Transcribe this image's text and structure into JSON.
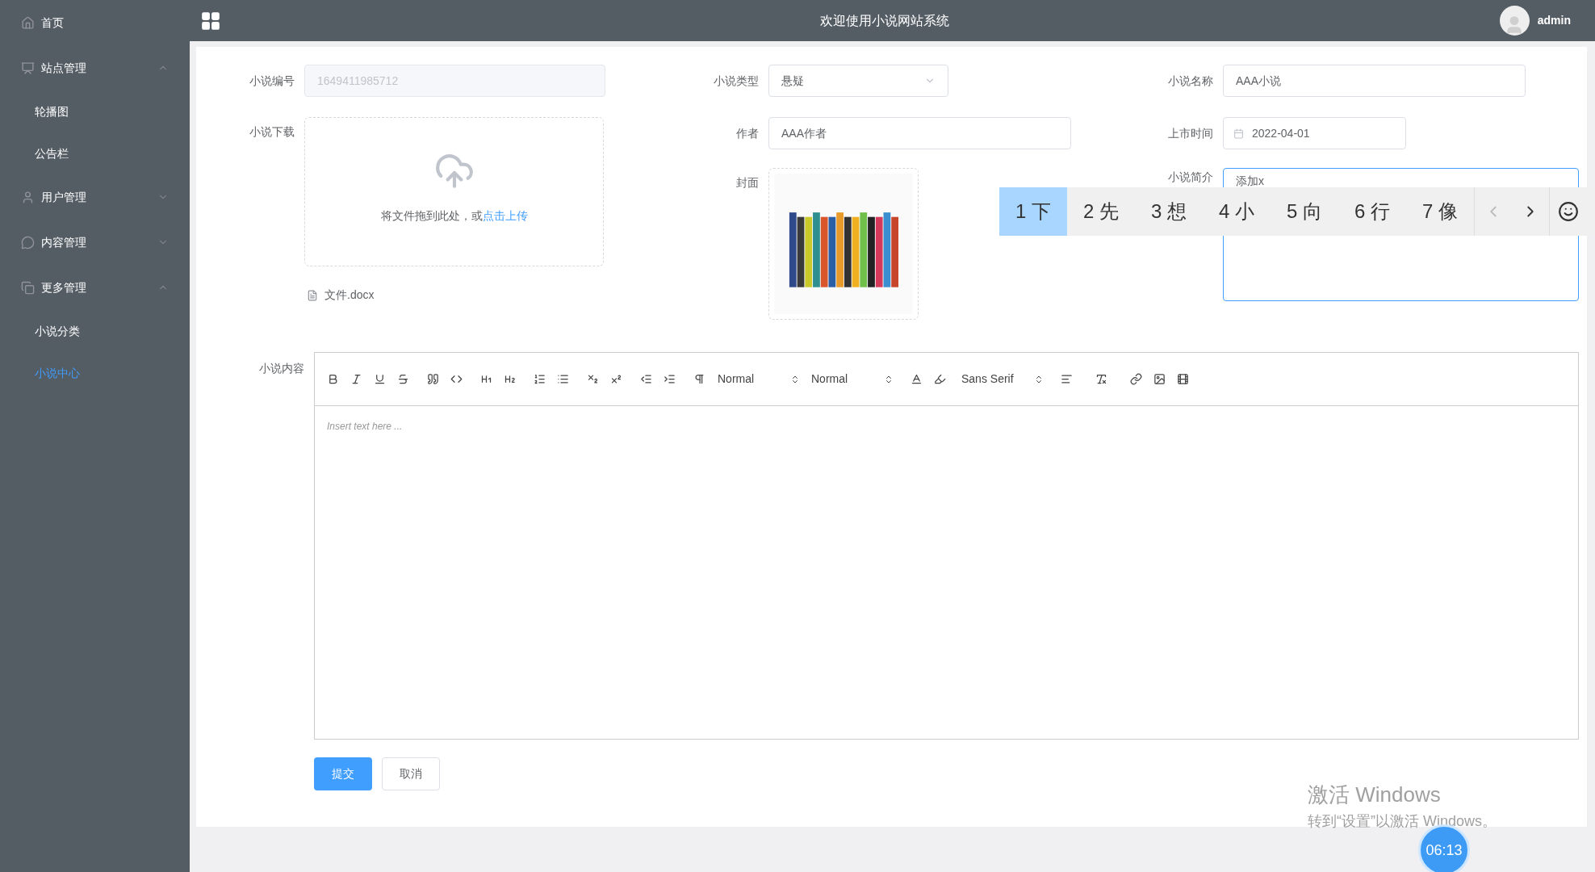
{
  "sidebar": {
    "items": [
      {
        "label": "首页",
        "kind": "link",
        "selected": false
      },
      {
        "label": "站点管理",
        "kind": "group",
        "expanded": true,
        "children": [
          {
            "label": "轮播图",
            "selected": false
          },
          {
            "label": "公告栏",
            "selected": false
          }
        ]
      },
      {
        "label": "用户管理",
        "kind": "group",
        "expanded": false
      },
      {
        "label": "内容管理",
        "kind": "group",
        "expanded": false
      },
      {
        "label": "更多管理",
        "kind": "group",
        "expanded": true,
        "children": [
          {
            "label": "小说分类",
            "selected": false
          },
          {
            "label": "小说中心",
            "selected": true
          }
        ]
      }
    ]
  },
  "header": {
    "title": "欢迎使用小说网站系统",
    "user": "admin"
  },
  "form": {
    "id": {
      "label": "小说编号",
      "value": "1649411985712",
      "disabled": true
    },
    "type": {
      "label": "小说类型",
      "value": "悬疑"
    },
    "name": {
      "label": "小说名称",
      "value": "AAA小说"
    },
    "download": {
      "label": "小说下载",
      "hint": "将文件拖到此处，或",
      "link": "点击上传",
      "file": "文件.docx"
    },
    "author": {
      "label": "作者",
      "value": "AAA作者"
    },
    "date": {
      "label": "上市时间",
      "value": "2022-04-01"
    },
    "cover": {
      "label": "封面",
      "kind": "picture"
    },
    "intro": {
      "label": "小说简介",
      "value": "添加x"
    },
    "content": {
      "label": "小说内容",
      "header_picker": "Normal",
      "size_picker": "Normal",
      "font_picker": "Sans Serif",
      "placeholder": "Insert text here ..."
    },
    "buttons": [
      {
        "label": "提交",
        "kind": "primary"
      },
      {
        "label": "取消",
        "kind": "default"
      }
    ]
  },
  "ime": {
    "candidates": [
      {
        "label": "1 下",
        "selected": true
      },
      {
        "label": "2 先",
        "selected": false
      },
      {
        "label": "3 想",
        "selected": false
      },
      {
        "label": "4 小",
        "selected": false
      },
      {
        "label": "5 向",
        "selected": false
      },
      {
        "label": "6 行",
        "selected": false
      },
      {
        "label": "7 像",
        "selected": false
      }
    ]
  },
  "watermark": {
    "title": "激活 Windows",
    "subtitle": "转到“设置”以激活 Windows。"
  },
  "timer": "06:13"
}
